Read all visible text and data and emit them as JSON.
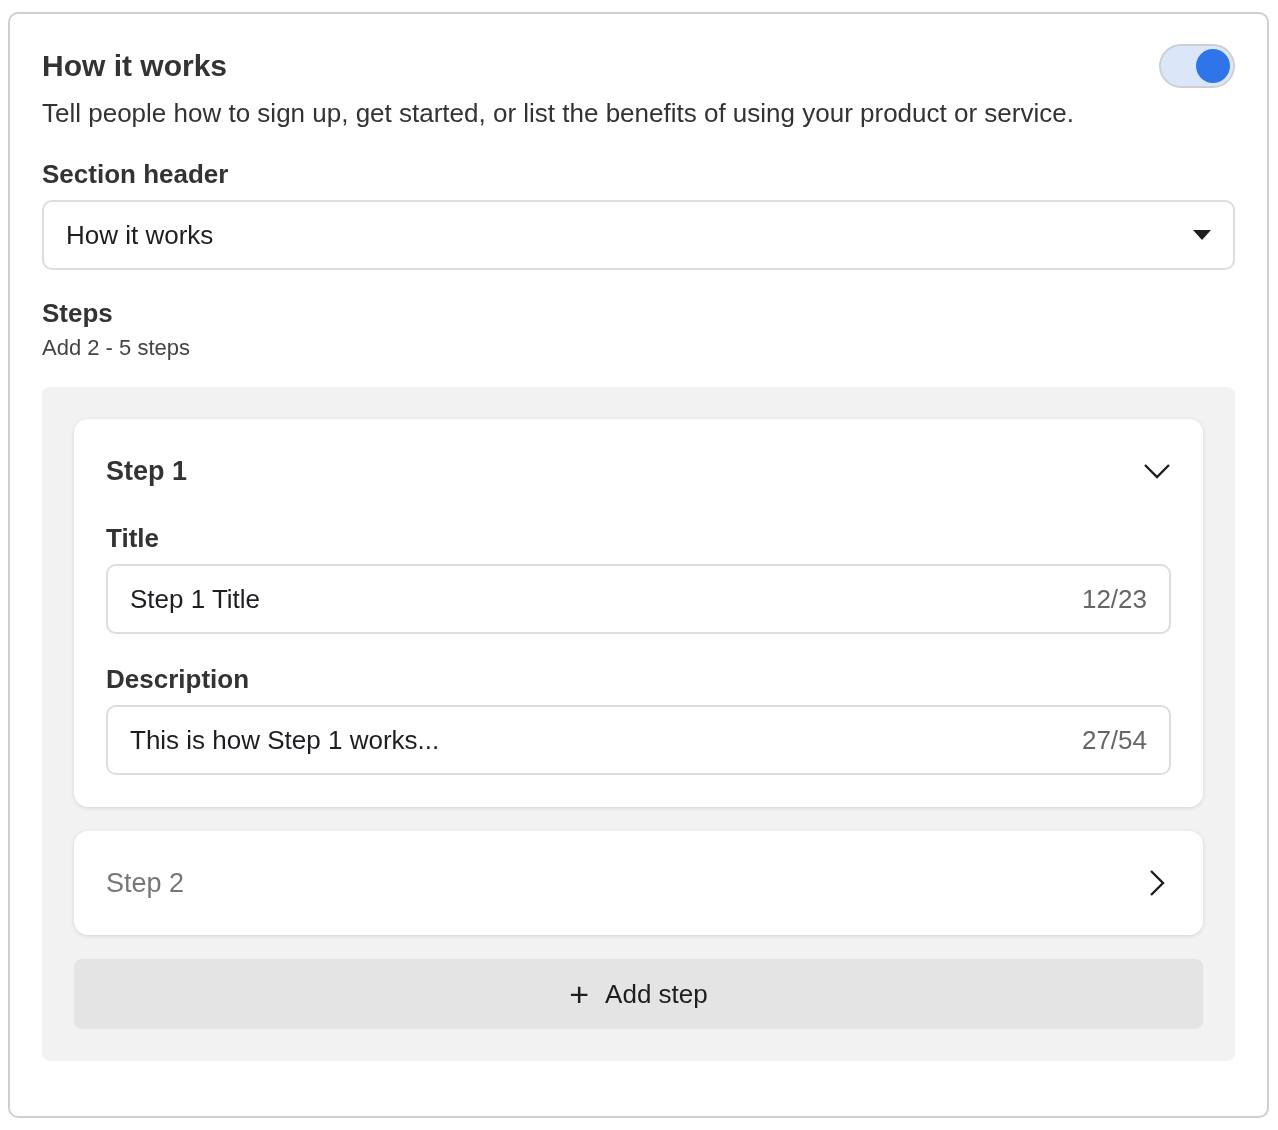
{
  "section": {
    "title": "How it works",
    "enabled": true,
    "description": "Tell people how to sign up, get started, or list the benefits of using your product or service."
  },
  "section_header": {
    "label": "Section header",
    "value": "How it works"
  },
  "steps": {
    "label": "Steps",
    "hint": "Add 2 - 5 steps",
    "items": [
      {
        "title": "Step 1",
        "expanded": true,
        "fields": [
          {
            "label": "Title",
            "value": "Step 1 Title",
            "count": "12/23"
          },
          {
            "label": "Description",
            "value": "This is how Step 1 works...",
            "count": "27/54"
          }
        ]
      },
      {
        "title": "Step 2",
        "expanded": false
      }
    ],
    "add_button": {
      "icon": "+",
      "label": "Add step"
    }
  }
}
